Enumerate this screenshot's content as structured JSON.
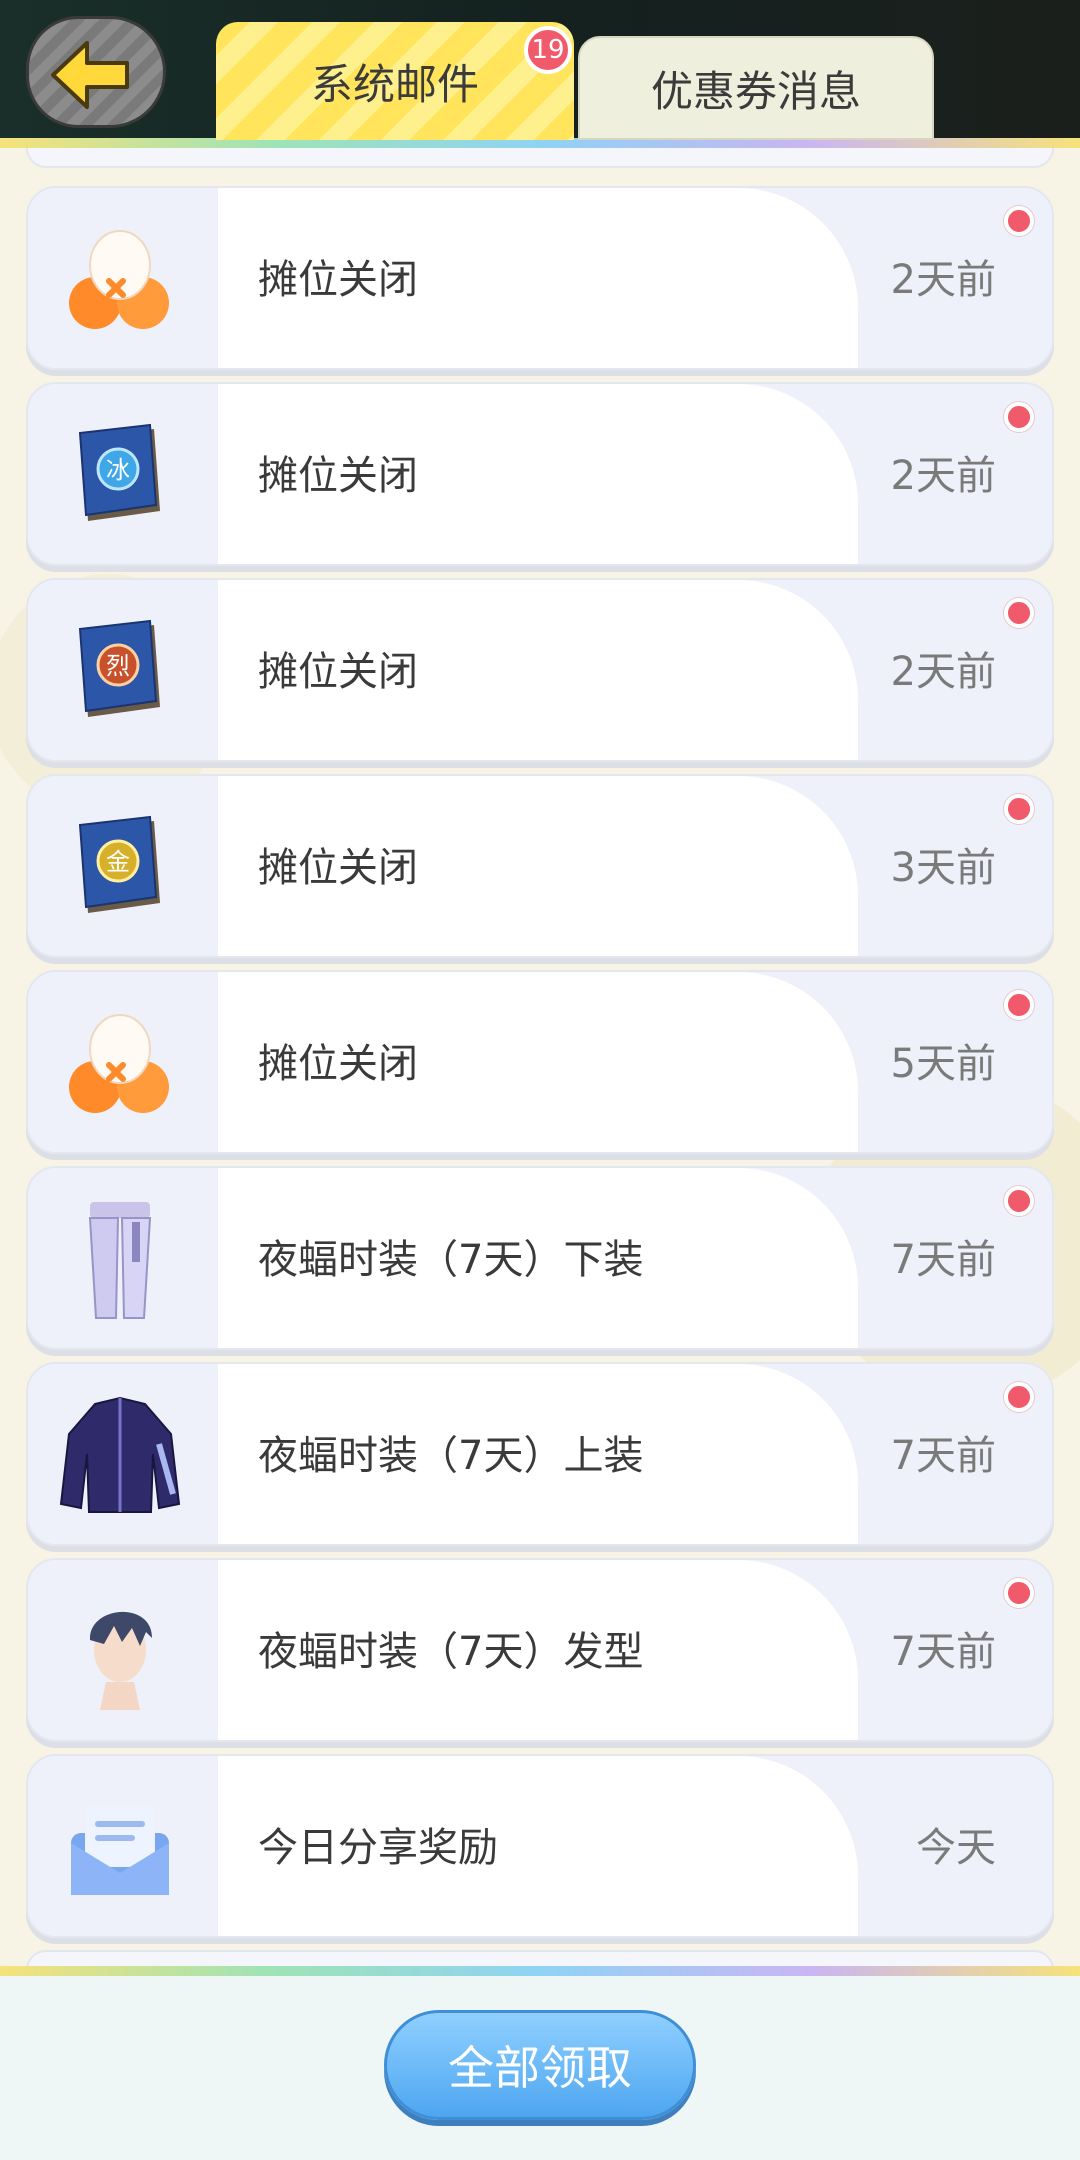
{
  "header": {
    "tabs": [
      {
        "label": "系统邮件",
        "active": true,
        "badge": "19"
      },
      {
        "label": "优惠券消息",
        "active": false
      }
    ]
  },
  "mails": [
    {
      "title": "摊位关闭",
      "time": "2天前",
      "icon": "capsule-icon",
      "unread": true
    },
    {
      "title": "摊位关闭",
      "time": "2天前",
      "icon": "ice-book-icon",
      "unread": true
    },
    {
      "title": "摊位关闭",
      "time": "2天前",
      "icon": "fire-book-icon",
      "unread": true
    },
    {
      "title": "摊位关闭",
      "time": "3天前",
      "icon": "gold-book-icon",
      "unread": true
    },
    {
      "title": "摊位关闭",
      "time": "5天前",
      "icon": "capsule-icon",
      "unread": true
    },
    {
      "title": "夜蝠时装（7天）下装",
      "time": "7天前",
      "icon": "pants-icon",
      "unread": true
    },
    {
      "title": "夜蝠时装（7天）上装",
      "time": "7天前",
      "icon": "jacket-icon",
      "unread": true
    },
    {
      "title": "夜蝠时装（7天）发型",
      "time": "7天前",
      "icon": "hairstyle-icon",
      "unread": true
    },
    {
      "title": "今日分享奖励",
      "time": "今天",
      "icon": "envelope-icon",
      "unread": false
    }
  ],
  "book_glyphs": {
    "ice": "冰",
    "fire": "烈",
    "gold": "金"
  },
  "footer": {
    "claim_all_label": "全部领取"
  },
  "colors": {
    "accent_yellow": "#ffe45c",
    "unread_dot": "#f05a6a",
    "button_blue": "#4ea6f0"
  }
}
